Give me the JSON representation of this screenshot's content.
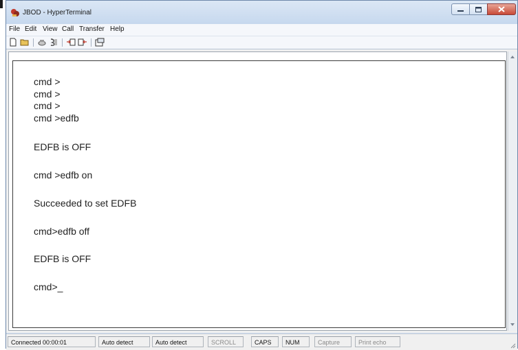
{
  "window": {
    "title": "JBOD - HyperTerminal",
    "icon": "hyperterminal-icon"
  },
  "menu": {
    "items": [
      "File",
      "Edit",
      "View",
      "Call",
      "Transfer",
      "Help"
    ]
  },
  "toolbar": {
    "icons": [
      "new-icon",
      "open-icon",
      "call-icon",
      "disconnect-icon",
      "send-icon",
      "receive-icon",
      "properties-icon"
    ]
  },
  "terminal": {
    "lines": [
      "cmd >",
      "cmd >",
      "cmd >",
      "cmd >edfb",
      "EDFB is OFF",
      "cmd >edfb on",
      "Succeeded to set EDFB",
      "cmd>edfb off",
      "EDFB is OFF",
      "cmd>_"
    ]
  },
  "statusbar": {
    "connected": "Connected 00:00:01",
    "detect1": "Auto detect",
    "detect2": "Auto detect",
    "scroll": "SCROLL",
    "caps": "CAPS",
    "num": "NUM",
    "capture": "Capture",
    "print_echo": "Print echo"
  },
  "colors": {
    "titlebar": "#c6d8ee",
    "close_button": "#c84a37"
  }
}
